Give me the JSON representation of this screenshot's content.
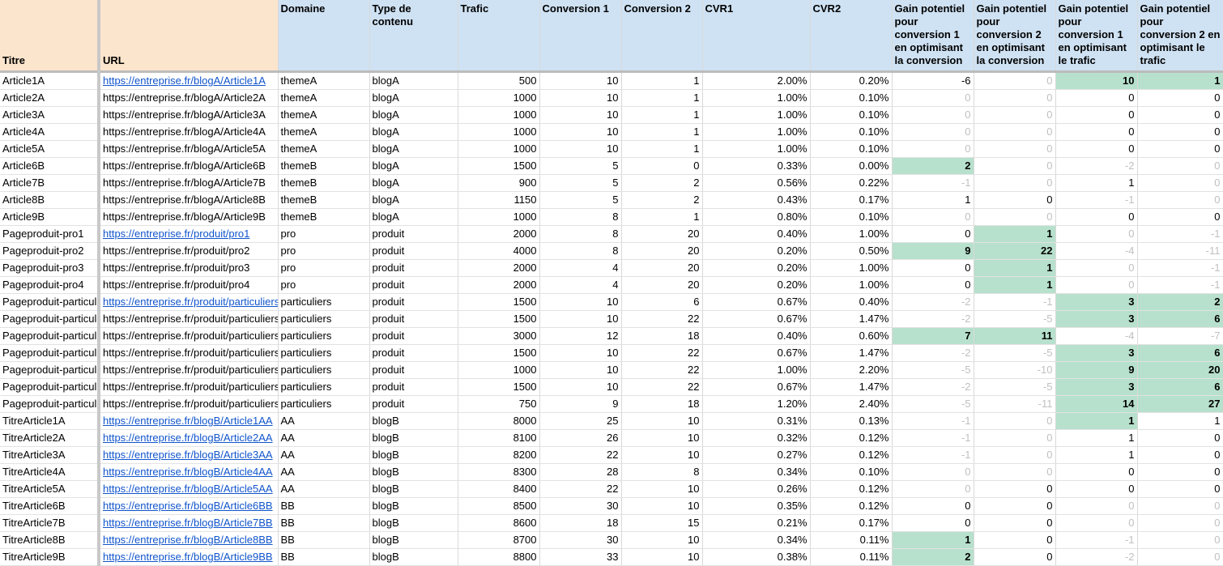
{
  "headers": {
    "titre": "Titre",
    "url": "URL",
    "domaine": "Domaine",
    "type": "Type de contenu",
    "trafic": "Trafic",
    "conv1": "Conversion 1",
    "conv2": "Conversion 2",
    "cvr1": "CVR1",
    "cvr2": "CVR2",
    "gain_c1_conv": "Gain potentiel pour conversion 1 en optimisant la conversion",
    "gain_c2_conv": "Gain potentiel pour conversion 2 en optimisant la conversion",
    "gain_c1_traf": "Gain potentiel pour conversion 1 en optimisant le trafic",
    "gain_c2_traf": "Gain potentiel pour conversion 2 en optimisant le trafic"
  },
  "colors": {
    "header_blue": "#cfe2f3",
    "header_peach": "#fce5cd",
    "highlight_green": "#b7e1cd",
    "link_blue": "#1155cc",
    "dim_gray": "#c0c0c0"
  },
  "rows": [
    {
      "titre": "Article1A",
      "url": "https://entreprise.fr/blogA/Article1A",
      "domaine": "themeA",
      "type": "blogA",
      "trafic": "500",
      "conv1": "10",
      "conv2": "1",
      "cvr1": "2.00%",
      "cvr2": "0.20%",
      "g1": "-6",
      "g2": "0",
      "g3": "10",
      "g4": "1"
    },
    {
      "titre": "Article2A",
      "url": "https://entreprise.fr/blogA/Article2A",
      "domaine": "themeA",
      "type": "blogA",
      "trafic": "1000",
      "conv1": "10",
      "conv2": "1",
      "cvr1": "1.00%",
      "cvr2": "0.10%",
      "g1": "0",
      "g2": "0",
      "g3": "0",
      "g4": "0"
    },
    {
      "titre": "Article3A",
      "url": "https://entreprise.fr/blogA/Article3A",
      "domaine": "themeA",
      "type": "blogA",
      "trafic": "1000",
      "conv1": "10",
      "conv2": "1",
      "cvr1": "1.00%",
      "cvr2": "0.10%",
      "g1": "0",
      "g2": "0",
      "g3": "0",
      "g4": "0"
    },
    {
      "titre": "Article4A",
      "url": "https://entreprise.fr/blogA/Article4A",
      "domaine": "themeA",
      "type": "blogA",
      "trafic": "1000",
      "conv1": "10",
      "conv2": "1",
      "cvr1": "1.00%",
      "cvr2": "0.10%",
      "g1": "0",
      "g2": "0",
      "g3": "0",
      "g4": "0"
    },
    {
      "titre": "Article5A",
      "url": "https://entreprise.fr/blogA/Article5A",
      "domaine": "themeA",
      "type": "blogA",
      "trafic": "1000",
      "conv1": "10",
      "conv2": "1",
      "cvr1": "1.00%",
      "cvr2": "0.10%",
      "g1": "0",
      "g2": "0",
      "g3": "0",
      "g4": "0"
    },
    {
      "titre": "Article6B",
      "url": "https://entreprise.fr/blogA/Article6B",
      "domaine": "themeB",
      "type": "blogA",
      "trafic": "1500",
      "conv1": "5",
      "conv2": "0",
      "cvr1": "0.33%",
      "cvr2": "0.00%",
      "g1": "2",
      "g2": "0",
      "g3": "-2",
      "g4": "0"
    },
    {
      "titre": "Article7B",
      "url": "https://entreprise.fr/blogA/Article7B",
      "domaine": "themeB",
      "type": "blogA",
      "trafic": "900",
      "conv1": "5",
      "conv2": "2",
      "cvr1": "0.56%",
      "cvr2": "0.22%",
      "g1": "-1",
      "g2": "0",
      "g3": "1",
      "g4": "0"
    },
    {
      "titre": "Article8B",
      "url": "https://entreprise.fr/blogA/Article8B",
      "domaine": "themeB",
      "type": "blogA",
      "trafic": "1150",
      "conv1": "5",
      "conv2": "2",
      "cvr1": "0.43%",
      "cvr2": "0.17%",
      "g1": "1",
      "g2": "0",
      "g3": "-1",
      "g4": "0"
    },
    {
      "titre": "Article9B",
      "url": "https://entreprise.fr/blogA/Article9B",
      "domaine": "themeB",
      "type": "blogA",
      "trafic": "1000",
      "conv1": "8",
      "conv2": "1",
      "cvr1": "0.80%",
      "cvr2": "0.10%",
      "g1": "0",
      "g2": "0",
      "g3": "0",
      "g4": "0"
    },
    {
      "titre": "Pageproduit-pro1",
      "url": "https://entreprise.fr/produit/pro1",
      "domaine": "pro",
      "type": "produit",
      "trafic": "2000",
      "conv1": "8",
      "conv2": "20",
      "cvr1": "0.40%",
      "cvr2": "1.00%",
      "g1": "0",
      "g2": "1",
      "g3": "0",
      "g4": "-1"
    },
    {
      "titre": "Pageproduit-pro2",
      "url": "https://entreprise.fr/produit/pro2",
      "domaine": "pro",
      "type": "produit",
      "trafic": "4000",
      "conv1": "8",
      "conv2": "20",
      "cvr1": "0.20%",
      "cvr2": "0.50%",
      "g1": "9",
      "g2": "22",
      "g3": "-4",
      "g4": "-11"
    },
    {
      "titre": "Pageproduit-pro3",
      "url": "https://entreprise.fr/produit/pro3",
      "domaine": "pro",
      "type": "produit",
      "trafic": "2000",
      "conv1": "4",
      "conv2": "20",
      "cvr1": "0.20%",
      "cvr2": "1.00%",
      "g1": "0",
      "g2": "1",
      "g3": "0",
      "g4": "-1"
    },
    {
      "titre": "Pageproduit-pro4",
      "url": "https://entreprise.fr/produit/pro4",
      "domaine": "pro",
      "type": "produit",
      "trafic": "2000",
      "conv1": "4",
      "conv2": "20",
      "cvr1": "0.20%",
      "cvr2": "1.00%",
      "g1": "0",
      "g2": "1",
      "g3": "0",
      "g4": "-1"
    },
    {
      "titre": "Pageproduit-particuli",
      "url": "https://entreprise.fr/produit/particuliers",
      "domaine": "particuliers",
      "type": "produit",
      "trafic": "1500",
      "conv1": "10",
      "conv2": "6",
      "cvr1": "0.67%",
      "cvr2": "0.40%",
      "g1": "-2",
      "g2": "-1",
      "g3": "3",
      "g4": "2"
    },
    {
      "titre": "Pageproduit-particuli",
      "url": "https://entreprise.fr/produit/particuliers",
      "domaine": "particuliers",
      "type": "produit",
      "trafic": "1500",
      "conv1": "10",
      "conv2": "22",
      "cvr1": "0.67%",
      "cvr2": "1.47%",
      "g1": "-2",
      "g2": "-5",
      "g3": "3",
      "g4": "6"
    },
    {
      "titre": "Pageproduit-particuli",
      "url": "https://entreprise.fr/produit/particuliers",
      "domaine": "particuliers",
      "type": "produit",
      "trafic": "3000",
      "conv1": "12",
      "conv2": "18",
      "cvr1": "0.40%",
      "cvr2": "0.60%",
      "g1": "7",
      "g2": "11",
      "g3": "-4",
      "g4": "-7"
    },
    {
      "titre": "Pageproduit-particuli",
      "url": "https://entreprise.fr/produit/particuliers",
      "domaine": "particuliers",
      "type": "produit",
      "trafic": "1500",
      "conv1": "10",
      "conv2": "22",
      "cvr1": "0.67%",
      "cvr2": "1.47%",
      "g1": "-2",
      "g2": "-5",
      "g3": "3",
      "g4": "6"
    },
    {
      "titre": "Pageproduit-particuli",
      "url": "https://entreprise.fr/produit/particuliers",
      "domaine": "particuliers",
      "type": "produit",
      "trafic": "1000",
      "conv1": "10",
      "conv2": "22",
      "cvr1": "1.00%",
      "cvr2": "2.20%",
      "g1": "-5",
      "g2": "-10",
      "g3": "9",
      "g4": "20"
    },
    {
      "titre": "Pageproduit-particuli",
      "url": "https://entreprise.fr/produit/particuliers",
      "domaine": "particuliers",
      "type": "produit",
      "trafic": "1500",
      "conv1": "10",
      "conv2": "22",
      "cvr1": "0.67%",
      "cvr2": "1.47%",
      "g1": "-2",
      "g2": "-5",
      "g3": "3",
      "g4": "6"
    },
    {
      "titre": "Pageproduit-particuli",
      "url": "https://entreprise.fr/produit/particuliers",
      "domaine": "particuliers",
      "type": "produit",
      "trafic": "750",
      "conv1": "9",
      "conv2": "18",
      "cvr1": "1.20%",
      "cvr2": "2.40%",
      "g1": "-5",
      "g2": "-11",
      "g3": "14",
      "g4": "27"
    },
    {
      "titre": "TitreArticle1A",
      "url": "https://entreprise.fr/blogB/Article1AA",
      "domaine": "AA",
      "type": "blogB",
      "trafic": "8000",
      "conv1": "25",
      "conv2": "10",
      "cvr1": "0.31%",
      "cvr2": "0.13%",
      "g1": "-1",
      "g2": "0",
      "g3": "1",
      "g4": "1"
    },
    {
      "titre": "TitreArticle2A",
      "url": "https://entreprise.fr/blogB/Article2AA",
      "domaine": "AA",
      "type": "blogB",
      "trafic": "8100",
      "conv1": "26",
      "conv2": "10",
      "cvr1": "0.32%",
      "cvr2": "0.12%",
      "g1": "-1",
      "g2": "0",
      "g3": "1",
      "g4": "0"
    },
    {
      "titre": "TitreArticle3A",
      "url": "https://entreprise.fr/blogB/Article3AA",
      "domaine": "AA",
      "type": "blogB",
      "trafic": "8200",
      "conv1": "22",
      "conv2": "10",
      "cvr1": "0.27%",
      "cvr2": "0.12%",
      "g1": "-1",
      "g2": "0",
      "g3": "1",
      "g4": "0"
    },
    {
      "titre": "TitreArticle4A",
      "url": "https://entreprise.fr/blogB/Article4AA",
      "domaine": "AA",
      "type": "blogB",
      "trafic": "8300",
      "conv1": "28",
      "conv2": "8",
      "cvr1": "0.34%",
      "cvr2": "0.10%",
      "g1": "0",
      "g2": "0",
      "g3": "0",
      "g4": "0"
    },
    {
      "titre": "TitreArticle5A",
      "url": "https://entreprise.fr/blogB/Article5AA",
      "domaine": "AA",
      "type": "blogB",
      "trafic": "8400",
      "conv1": "22",
      "conv2": "10",
      "cvr1": "0.26%",
      "cvr2": "0.12%",
      "g1": "0",
      "g2": "0",
      "g3": "0",
      "g4": "0"
    },
    {
      "titre": "TitreArticle6B",
      "url": "https://entreprise.fr/blogB/Article6BB",
      "domaine": "BB",
      "type": "blogB",
      "trafic": "8500",
      "conv1": "30",
      "conv2": "10",
      "cvr1": "0.35%",
      "cvr2": "0.12%",
      "g1": "0",
      "g2": "0",
      "g3": "0",
      "g4": "0"
    },
    {
      "titre": "TitreArticle7B",
      "url": "https://entreprise.fr/blogB/Article7BB",
      "domaine": "BB",
      "type": "blogB",
      "trafic": "8600",
      "conv1": "18",
      "conv2": "15",
      "cvr1": "0.21%",
      "cvr2": "0.17%",
      "g1": "0",
      "g2": "0",
      "g3": "0",
      "g4": "0"
    },
    {
      "titre": "TitreArticle8B",
      "url": "https://entreprise.fr/blogB/Article8BB",
      "domaine": "BB",
      "type": "blogB",
      "trafic": "8700",
      "conv1": "30",
      "conv2": "10",
      "cvr1": "0.34%",
      "cvr2": "0.11%",
      "g1": "1",
      "g2": "0",
      "g3": "-1",
      "g4": "0"
    },
    {
      "titre": "TitreArticle9B",
      "url": "https://entreprise.fr/blogB/Article9BB",
      "domaine": "BB",
      "type": "blogB",
      "trafic": "8800",
      "conv1": "33",
      "conv2": "10",
      "cvr1": "0.38%",
      "cvr2": "0.11%",
      "g1": "2",
      "g2": "0",
      "g3": "-2",
      "g4": "0"
    }
  ]
}
